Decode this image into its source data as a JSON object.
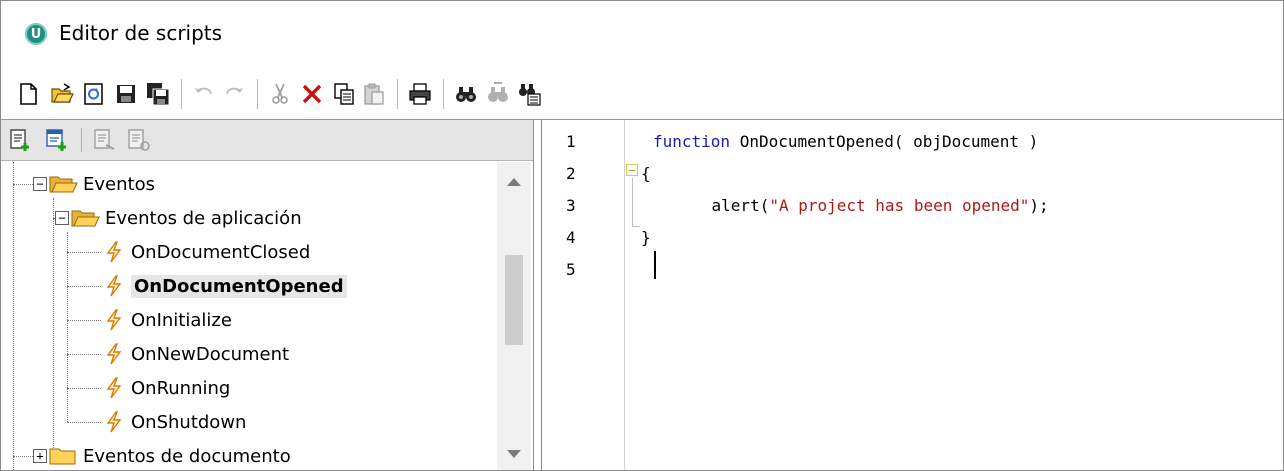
{
  "window": {
    "title": "Editor de scripts",
    "logo_letter": "U"
  },
  "toolbar": {
    "buttons": [
      {
        "name": "new-file-icon",
        "enabled": true
      },
      {
        "name": "open-file-icon",
        "enabled": true
      },
      {
        "name": "reload-icon",
        "enabled": true
      },
      {
        "name": "save-icon",
        "enabled": true
      },
      {
        "name": "save-all-icon",
        "enabled": true
      },
      {
        "name": "undo-icon",
        "enabled": false
      },
      {
        "name": "redo-icon",
        "enabled": false
      },
      {
        "name": "cut-icon",
        "enabled": false
      },
      {
        "name": "delete-icon",
        "enabled": true
      },
      {
        "name": "copy-icon",
        "enabled": true
      },
      {
        "name": "paste-icon",
        "enabled": false
      },
      {
        "name": "print-icon",
        "enabled": true
      },
      {
        "name": "find-icon",
        "enabled": true
      },
      {
        "name": "find-next-icon",
        "enabled": false
      },
      {
        "name": "replace-icon",
        "enabled": true
      }
    ]
  },
  "left_toolbar": {
    "buttons": [
      {
        "name": "add-macro-icon",
        "enabled": true
      },
      {
        "name": "add-form-icon",
        "enabled": true
      },
      {
        "name": "remove-macro-icon",
        "enabled": false
      },
      {
        "name": "properties-icon",
        "enabled": false
      }
    ]
  },
  "tree": {
    "root": {
      "label": "Eventos",
      "expanded": true
    },
    "group_app": {
      "label": "Eventos de aplicación",
      "expanded": true
    },
    "events": [
      {
        "label": "OnDocumentClosed",
        "selected": false
      },
      {
        "label": "OnDocumentOpened",
        "selected": true
      },
      {
        "label": "OnInitialize",
        "selected": false
      },
      {
        "label": "OnNewDocument",
        "selected": false
      },
      {
        "label": "OnRunning",
        "selected": false
      },
      {
        "label": "OnShutdown",
        "selected": false
      }
    ],
    "group_doc": {
      "label": "Eventos de documento",
      "expanded": false
    }
  },
  "editor": {
    "line_numbers": [
      "1",
      "2",
      "3",
      "4",
      "5"
    ],
    "lines": {
      "l1_keyword": "function",
      "l1_rest": " OnDocumentOpened( objDocument )",
      "l2": "{",
      "l3_call": "    alert(",
      "l3_string": "\"A project has been opened\"",
      "l3_end": ");",
      "l4": "}",
      "l5": ""
    },
    "colors": {
      "keyword": "#1a1ac0",
      "string": "#b01818"
    }
  }
}
